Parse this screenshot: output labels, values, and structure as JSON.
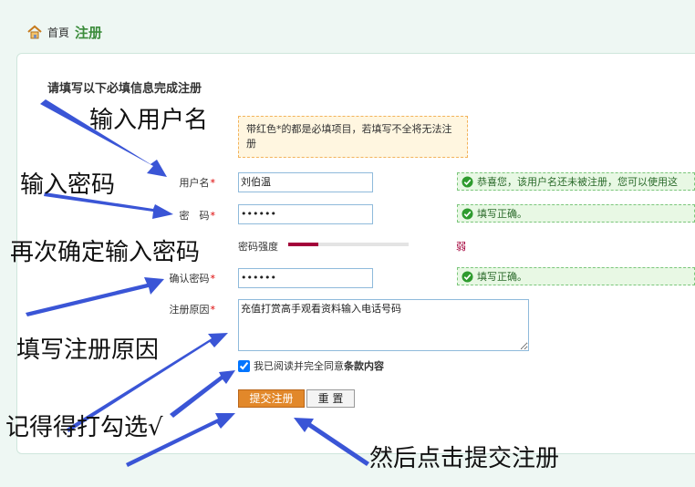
{
  "breadcrumb": {
    "home": "首頁",
    "current": "注册"
  },
  "form": {
    "heading": "请填写以下必填信息完成注册",
    "notice": "带红色*的都是必填项目，若填写不全将无法注册",
    "required_mark": "*",
    "username": {
      "label": "用户名",
      "value": "刘伯温",
      "message": "恭喜您，该用户名还未被注册，您可以使用这"
    },
    "password": {
      "label": "密　码",
      "value": "••••••",
      "message": "填写正确。"
    },
    "strength": {
      "label": "密码强度",
      "level_text": "弱",
      "level_fraction": 0.25,
      "color": "#a3003a"
    },
    "confirm": {
      "label": "确认密码",
      "value": "••••••",
      "message": "填写正确。"
    },
    "reason": {
      "label": "注册原因",
      "value": "充值打赏高手观看资料输入电话号码"
    },
    "agree": {
      "checked": true,
      "prefix": "我已阅读并完全同意",
      "link": "条款内容"
    },
    "submit_label": "提交注册",
    "reset_label": "重 置"
  },
  "annotations": {
    "username": "输入用户名",
    "password": "输入密码",
    "confirm": "再次确定输入密码",
    "reason": "填写注册原因",
    "check": "记得得打勾选√",
    "submit": "然后点击提交注册"
  },
  "colors": {
    "accent_green": "#3b8c3b",
    "submit_orange": "#e2882a",
    "arrow_blue": "#3a55d6"
  }
}
